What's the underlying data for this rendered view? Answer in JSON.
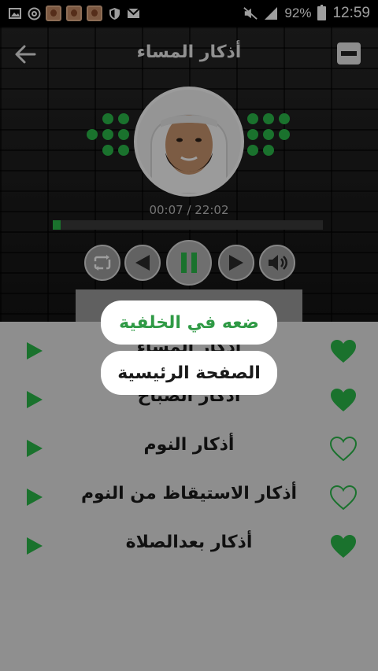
{
  "status_bar": {
    "battery": "92%",
    "time": "12:59",
    "icons": [
      "image-icon",
      "at-icon",
      "photo-thumb-1",
      "photo-thumb-2",
      "photo-thumb-3",
      "shield-icon",
      "mail-icon",
      "mute-icon",
      "signal-icon",
      "battery-icon"
    ]
  },
  "header": {
    "title": "أذكار المساء",
    "back_icon": "back-arrow-icon",
    "menu_icon": "menu-icon"
  },
  "player": {
    "time": "00:07 / 22:02",
    "progress": 0.03,
    "controls": [
      "repeat-icon",
      "previous-icon",
      "pause-icon",
      "next-icon",
      "volume-icon"
    ],
    "accent": "#2ab84a"
  },
  "popup": {
    "background_label": "ضعه في الخلفية",
    "home_label": "الصفحة الرئيسية"
  },
  "list": [
    {
      "title": "أذكار المساء",
      "favorite": true
    },
    {
      "title": "أذكار الصباح",
      "favorite": true
    },
    {
      "title": "أذكار النوم",
      "favorite": false
    },
    {
      "title": "أذكار الاستيقاظ من النوم",
      "favorite": false
    },
    {
      "title": "أذكار بعدالصلاة",
      "favorite": true
    }
  ]
}
